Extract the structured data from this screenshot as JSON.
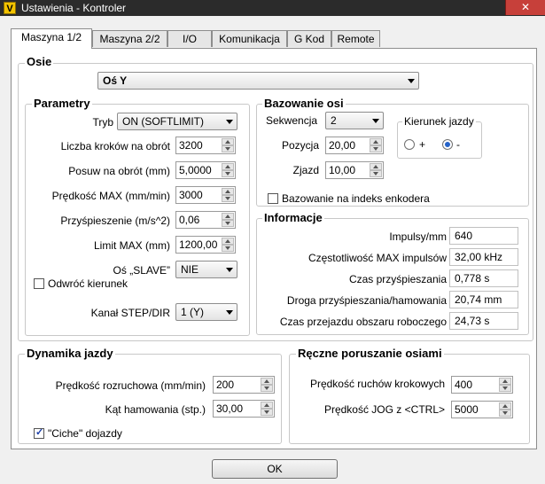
{
  "window": {
    "title": "Ustawienia - Kontroler",
    "close": "✕",
    "icon": "V"
  },
  "tabs": [
    "Maszyna 1/2",
    "Maszyna 2/2",
    "I/O",
    "Komunikacja",
    "G Kod",
    "Remote"
  ],
  "osie": {
    "title": "Osie",
    "selected_axis": "Oś Y"
  },
  "parametry": {
    "title": "Parametry",
    "tryb_label": "Tryb",
    "tryb_value": "ON (SOFTLIMIT)",
    "kroki_label": "Liczba kroków na obrót",
    "kroki_value": "3200",
    "posuw_label": "Posuw na obrót (mm)",
    "posuw_value": "5,0000",
    "predkosc_label": "Prędkość MAX (mm/min)",
    "predkosc_value": "3000",
    "przysp_label": "Przyśpieszenie (m/s^2)",
    "przysp_value": "0,06",
    "limit_label": "Limit MAX (mm)",
    "limit_value": "1200,00",
    "slave_label": "Oś „SLAVE”",
    "slave_value": "NIE",
    "odwroc_label": "Odwróć kierunek",
    "odwroc_checked": false,
    "kanal_label": "Kanał STEP/DIR",
    "kanal_value": "1 (Y)"
  },
  "bazowanie": {
    "title": "Bazowanie osi",
    "sekwencja_label": "Sekwencja",
    "sekwencja_value": "2",
    "pozycja_label": "Pozycja",
    "pozycja_value": "20,00",
    "zjazd_label": "Zjazd",
    "zjazd_value": "10,00",
    "kierunek_title": "Kierunek jazdy",
    "plus_label": "+",
    "minus_label": "-",
    "selected": "-",
    "enkoder_label": "Bazowanie na indeks enkodera",
    "enkoder_checked": false
  },
  "informacje": {
    "title": "Informacje",
    "rows": [
      {
        "label": "Impulsy/mm",
        "value": "640"
      },
      {
        "label": "Częstotliwość MAX impulsów",
        "value": "32,00 kHz"
      },
      {
        "label": "Czas przyśpieszania",
        "value": "0,778 s"
      },
      {
        "label": "Droga przyśpieszania/hamowania",
        "value": "20,74 mm"
      },
      {
        "label": "Czas przejazdu obszaru roboczego",
        "value": "24,73 s"
      }
    ]
  },
  "dynamika": {
    "title": "Dynamika jazdy",
    "rozruch_label": "Prędkość rozruchowa (mm/min)",
    "rozruch_value": "200",
    "kat_label": "Kąt hamowania (stp.)",
    "kat_value": "30,00",
    "ciche_label": "\"Ciche\" dojazdy",
    "ciche_checked": true
  },
  "reczne": {
    "title": "Ręczne poruszanie osiami",
    "krokowe_label": "Prędkość ruchów krokowych",
    "krokowe_value": "400",
    "jog_label": "Prędkość  JOG z <CTRL>",
    "jog_value": "5000"
  },
  "ok_label": "OK",
  "check_mark": "✓"
}
